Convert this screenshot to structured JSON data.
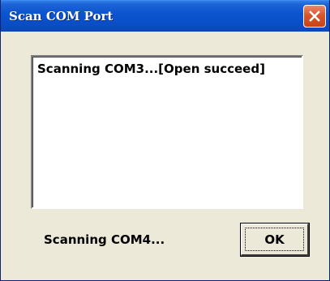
{
  "window": {
    "title": "Scan COM Port"
  },
  "log": {
    "lines": [
      "Scanning COM3...[Open succeed]"
    ]
  },
  "status": {
    "text": "Scanning COM4..."
  },
  "buttons": {
    "ok_label": "OK"
  },
  "colors": {
    "titlebar": "#0a4fc8",
    "close_button": "#d9552c",
    "dialog_bg": "#ece9d8"
  },
  "icons": {
    "close": "close-icon"
  }
}
